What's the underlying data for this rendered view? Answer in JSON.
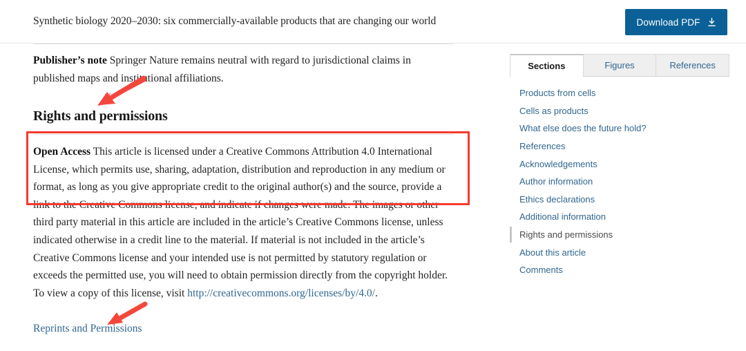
{
  "header": {
    "article_title": "Synthetic biology 2020–2030: six commercially-available products that are changing our world",
    "download_button_label": "Download PDF",
    "download_icon": "download-icon",
    "button_color": "#0b6197"
  },
  "article": {
    "publishers_note_lead": "Publisher’s note",
    "publishers_note_text": " Springer Nature remains neutral with regard to jurisdictional claims in published maps and institutional affiliations.",
    "rights_heading": "Rights and permissions",
    "license_lead": "Open Access",
    "license_text_part1": " This article is licensed under a Creative Commons Attribution 4.0 International License, which permits use, sharing, adaptation, distribution and reproduction in any medium or format, as long as you give appropriate credit to the original author(s) and the source, provide a link to the Creative Commons license, and indicate if changes were made. The images or other third party material in this article are included in the article’s Creative Commons license, unless indicated otherwise in a credit line to the material. If material is not included in the article’s Creative Commons license and your intended use is not permitted by statutory regulation or exceeds the permitted use, you will need to obtain permission directly from the copyright holder. To view a copy of this license, visit ",
    "license_url": "http://creativecommons.org/licenses/by/4.0/",
    "license_text_part2": ".",
    "reprints_link": "Reprints and Permissions",
    "link_color": "#31668f"
  },
  "annotations": {
    "box_color": "#f6392e",
    "arrow_color": "#f4473c",
    "box_target": "open-access-license-paragraph",
    "arrow1_target": "rights-and-permissions-heading",
    "arrow2_target": "reprints-and-permissions-link"
  },
  "sidebar": {
    "tabs": [
      {
        "label": "Sections",
        "active": true
      },
      {
        "label": "Figures",
        "active": false
      },
      {
        "label": "References",
        "active": false
      }
    ],
    "sections": [
      {
        "label": "Products from cells",
        "active": false
      },
      {
        "label": "Cells as products",
        "active": false
      },
      {
        "label": "What else does the future hold?",
        "active": false
      },
      {
        "label": "References",
        "active": false
      },
      {
        "label": "Acknowledgements",
        "active": false
      },
      {
        "label": "Author information",
        "active": false
      },
      {
        "label": "Ethics declarations",
        "active": false
      },
      {
        "label": "Additional information",
        "active": false
      },
      {
        "label": "Rights and permissions",
        "active": true
      },
      {
        "label": "About this article",
        "active": false
      },
      {
        "label": "Comments",
        "active": false
      }
    ]
  }
}
